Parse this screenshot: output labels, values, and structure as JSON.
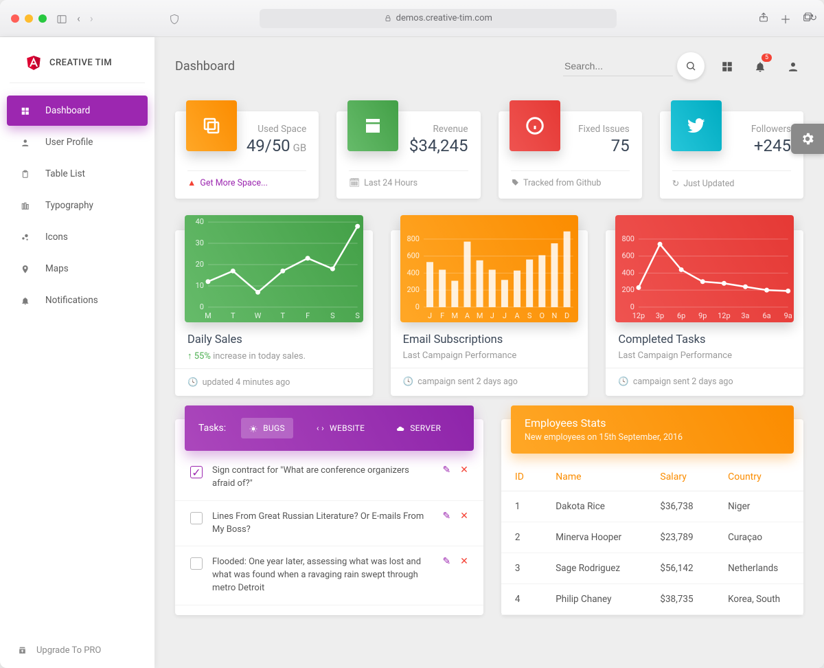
{
  "browser": {
    "url": "demos.creative-tim.com"
  },
  "brand": {
    "name": "CREATIVE TIM"
  },
  "sidebar": {
    "items": [
      {
        "label": "Dashboard"
      },
      {
        "label": "User Profile"
      },
      {
        "label": "Table List"
      },
      {
        "label": "Typography"
      },
      {
        "label": "Icons"
      },
      {
        "label": "Maps"
      },
      {
        "label": "Notifications"
      }
    ],
    "upgrade_label": "Upgrade To PRO"
  },
  "header": {
    "title": "Dashboard",
    "search_placeholder": "Search...",
    "notifications_count": "5"
  },
  "stats": [
    {
      "label": "Used Space",
      "value": "49/50",
      "unit": "GB",
      "footer": "Get More Space...",
      "footer_type": "warn-link"
    },
    {
      "label": "Revenue",
      "value": "$34,245",
      "footer": "Last 24 Hours",
      "footer_type": "clock"
    },
    {
      "label": "Fixed Issues",
      "value": "75",
      "footer": "Tracked from Github",
      "footer_type": "tag"
    },
    {
      "label": "Followers",
      "value": "+245",
      "footer": "Just Updated",
      "footer_type": "refresh"
    }
  ],
  "charts": [
    {
      "title": "Daily Sales",
      "subtitle_prefix": "↑ 55%",
      "subtitle_rest": " increase in today sales.",
      "footer": "updated 4 minutes ago"
    },
    {
      "title": "Email Subscriptions",
      "subtitle": "Last Campaign Performance",
      "footer": "campaign sent 2 days ago"
    },
    {
      "title": "Completed Tasks",
      "subtitle": "Last Campaign Performance",
      "footer": "campaign sent 2 days ago"
    }
  ],
  "chart_data": [
    {
      "type": "line",
      "categories": [
        "M",
        "T",
        "W",
        "T",
        "F",
        "S",
        "S"
      ],
      "values": [
        12,
        17,
        7,
        17,
        23,
        18,
        38
      ],
      "ylim": [
        0,
        40
      ],
      "yticks": [
        0,
        10,
        20,
        30,
        40
      ],
      "title": "Daily Sales"
    },
    {
      "type": "bar",
      "categories": [
        "J",
        "F",
        "M",
        "A",
        "M",
        "J",
        "J",
        "A",
        "S",
        "O",
        "N",
        "D"
      ],
      "values": [
        530,
        440,
        310,
        770,
        550,
        440,
        320,
        430,
        560,
        610,
        750,
        890
      ],
      "ylim": [
        0,
        1000
      ],
      "yticks": [
        0,
        200,
        400,
        600,
        800
      ],
      "title": "Email Subscriptions"
    },
    {
      "type": "line",
      "categories": [
        "12p",
        "3p",
        "6p",
        "9p",
        "12p",
        "3a",
        "6a",
        "9a"
      ],
      "values": [
        230,
        740,
        440,
        300,
        280,
        240,
        200,
        190
      ],
      "ylim": [
        0,
        1000
      ],
      "yticks": [
        0,
        200,
        400,
        600,
        800
      ],
      "title": "Completed Tasks"
    }
  ],
  "tasks": {
    "label": "Tasks:",
    "tabs": [
      "BUGS",
      "WEBSITE",
      "SERVER"
    ],
    "items": [
      {
        "text": "Sign contract for \"What are conference organizers afraid of?\"",
        "checked": true
      },
      {
        "text": "Lines From Great Russian Literature? Or E-mails From My Boss?",
        "checked": false
      },
      {
        "text": "Flooded: One year later, assessing what was lost and what was found when a ravaging rain swept through metro Detroit",
        "checked": false
      }
    ]
  },
  "employees": {
    "title": "Employees Stats",
    "subtitle": "New employees on 15th September, 2016",
    "columns": [
      "ID",
      "Name",
      "Salary",
      "Country"
    ],
    "rows": [
      {
        "id": "1",
        "name": "Dakota Rice",
        "salary": "$36,738",
        "country": "Niger"
      },
      {
        "id": "2",
        "name": "Minerva Hooper",
        "salary": "$23,789",
        "country": "Curaçao"
      },
      {
        "id": "3",
        "name": "Sage Rodriguez",
        "salary": "$56,142",
        "country": "Netherlands"
      },
      {
        "id": "4",
        "name": "Philip Chaney",
        "salary": "$38,735",
        "country": "Korea, South"
      }
    ]
  }
}
